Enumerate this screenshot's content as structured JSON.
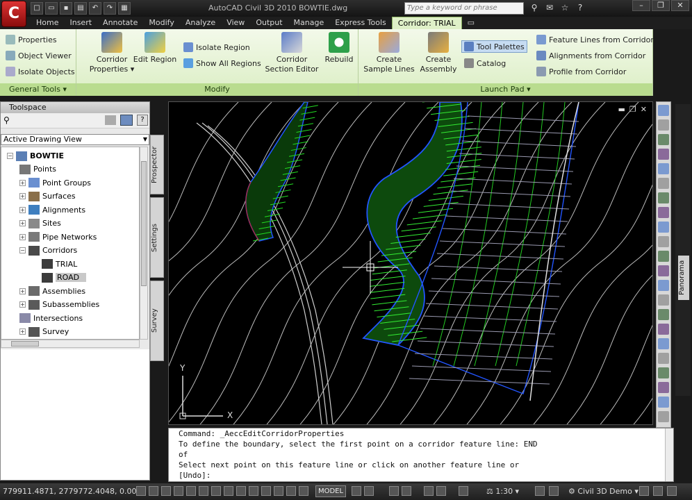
{
  "title": {
    "app_logo": "C",
    "text": "AutoCAD Civil 3D 2010    BOWTIE.dwg",
    "search_placeholder": "Type a keyword or phrase"
  },
  "tabs": [
    "Home",
    "Insert",
    "Annotate",
    "Modify",
    "Analyze",
    "View",
    "Output",
    "Manage",
    "Express Tools",
    "Corridor: TRIAL"
  ],
  "active_tab": "Corridor: TRIAL",
  "ribbon": {
    "general_tools": {
      "items": [
        "Properties",
        "Object Viewer",
        "Isolate Objects"
      ],
      "title": "General Tools"
    },
    "modify": {
      "corridor_properties_1": "Corridor",
      "corridor_properties_2": "Properties",
      "edit_region": "Edit Region",
      "isolate_region": "Isolate Region",
      "show_all_regions": "Show All Regions",
      "section_editor_1": "Corridor",
      "section_editor_2": "Section Editor",
      "rebuild": "Rebuild",
      "title": "Modify"
    },
    "launch_pad": {
      "sample_lines_1": "Create",
      "sample_lines_2": "Sample Lines",
      "assembly_1": "Create",
      "assembly_2": "Assembly",
      "tool_palettes": "Tool Palettes",
      "catalog": "Catalog",
      "feature_lines": "Feature Lines from Corridor",
      "alignments": "Alignments from Corridor",
      "profile": "Profile from Corridor",
      "title": "Launch Pad"
    }
  },
  "toolspace": {
    "title": "Toolspace",
    "view": "Active Drawing View",
    "tree": {
      "root": "BOWTIE",
      "items": [
        "Points",
        "Point Groups",
        "Surfaces",
        "Alignments",
        "Sites",
        "Pipe Networks",
        "Corridors"
      ],
      "corridors": [
        "TRIAL",
        "ROAD"
      ],
      "items_after": [
        "Assemblies",
        "Subassemblies",
        "Intersections",
        "Survey"
      ]
    },
    "side_tabs": [
      "Prospector",
      "Settings",
      "Survey"
    ]
  },
  "viewport": {
    "ucs_y": "Y",
    "ucs_x": "X"
  },
  "panorama": "Panorama",
  "command": {
    "lines": [
      "Command: _AeccEditCorridorProperties",
      "To define the boundary, select the first point on a corridor feature line: END",
      "of",
      "Select next point on this feature line or click on another feature line or",
      "[Undo]:"
    ]
  },
  "status": {
    "coords": "779911.4871, 2779772.4048, 0.0000",
    "model": "MODEL",
    "scale": "1:30",
    "workspace": "Civil 3D Demo"
  },
  "colors": {
    "ribbon_green": "#b9dc8f",
    "corridor_green": "#22dd22",
    "boundary_blue": "#2255ff",
    "contour": "#bcbcbc"
  }
}
